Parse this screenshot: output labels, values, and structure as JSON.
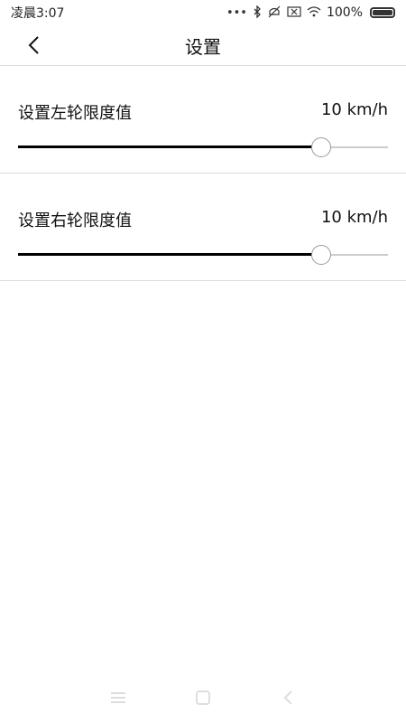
{
  "status_bar": {
    "time": "凌晨3:07",
    "dots": "•••",
    "battery_text": "100%"
  },
  "header": {
    "title": "设置"
  },
  "settings": [
    {
      "label": "设置左轮限度值",
      "value": "10 km/h",
      "fill_fraction": 0.82
    },
    {
      "label": "设置右轮限度值",
      "value": "10 km/h",
      "fill_fraction": 0.82
    }
  ],
  "icons": {
    "back": "back-arrow-icon",
    "menu": "menu-icon",
    "home": "home-icon",
    "nav_back": "nav-back-icon"
  }
}
